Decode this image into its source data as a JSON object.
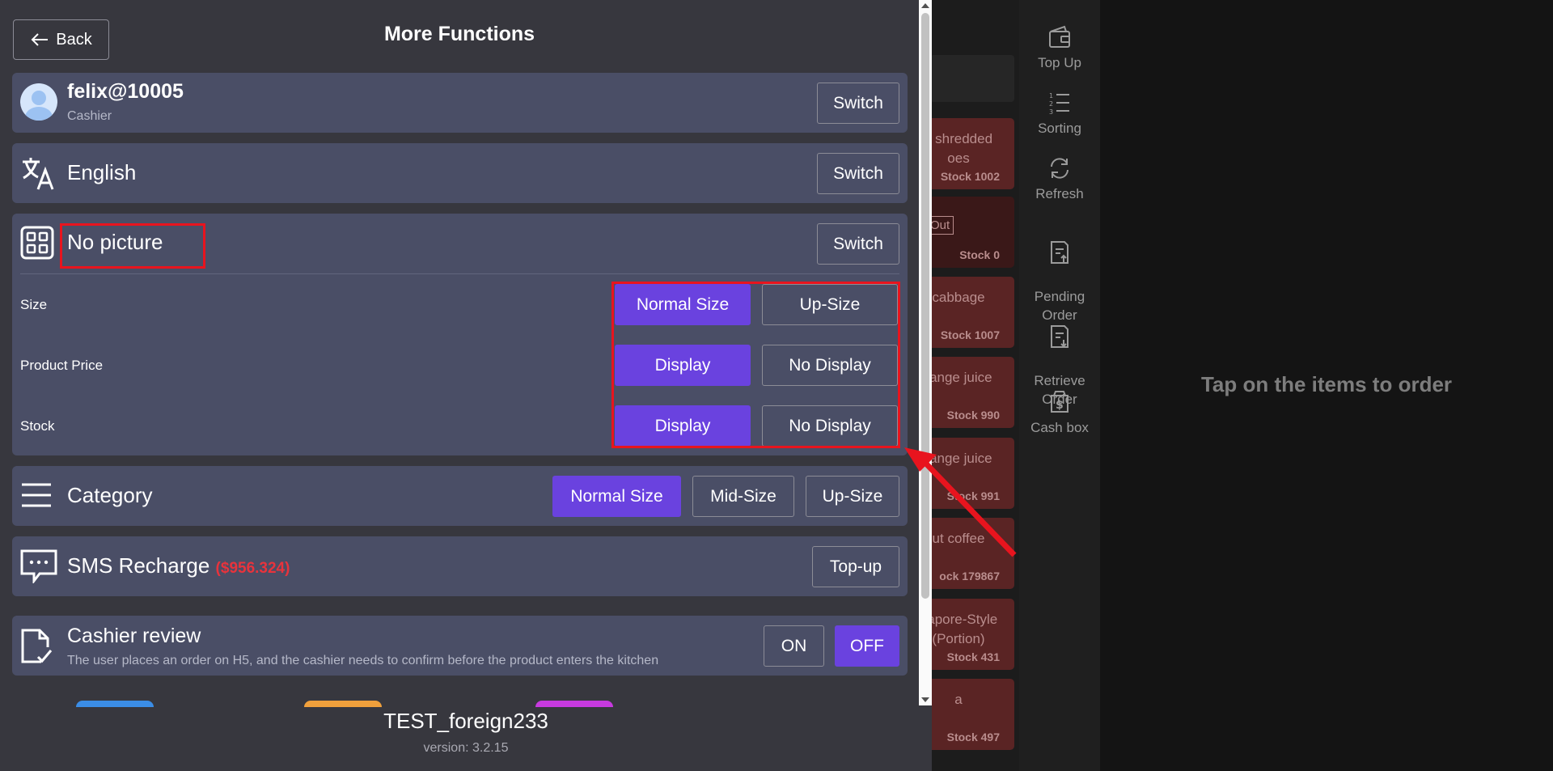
{
  "panel": {
    "back_label": "Back",
    "title": "More Functions"
  },
  "account": {
    "name": "felix@10005",
    "role": "Cashier",
    "switch_label": "Switch"
  },
  "language": {
    "label": "English",
    "switch_label": "Switch"
  },
  "display_mode": {
    "label": "No picture",
    "switch_label": "Switch",
    "rows": [
      {
        "label": "Size",
        "options": [
          "Normal Size",
          "Up-Size"
        ],
        "selected": 0
      },
      {
        "label": "Product Price",
        "options": [
          "Display",
          "No Display"
        ],
        "selected": 0
      },
      {
        "label": "Stock",
        "options": [
          "Display",
          "No Display"
        ],
        "selected": 0
      }
    ]
  },
  "category": {
    "label": "Category",
    "options": [
      "Normal Size",
      "Mid-Size",
      "Up-Size"
    ],
    "selected": 0
  },
  "sms": {
    "label": "SMS Recharge",
    "balance": "($956.324)",
    "topup_label": "Top-up"
  },
  "cashier_review": {
    "label": "Cashier review",
    "description": "The user places an order on H5, and the cashier needs to confirm before the product enters the kitchen",
    "on_label": "ON",
    "off_label": "OFF",
    "selected": "OFF"
  },
  "footer": {
    "store_name": "TEST_foreign233",
    "version": "version: 3.2.15"
  },
  "background": {
    "products": [
      {
        "name": "y shredded\noes",
        "stock": "Stock 1002"
      },
      {
        "name": "",
        "tag": "Out",
        "stock": "Stock 0"
      },
      {
        "name": "cabbage",
        "stock": "Stock 1007"
      },
      {
        "name": "range juice",
        "stock": "Stock 990"
      },
      {
        "name": "range juice",
        "stock": "Stock 991"
      },
      {
        "name": "ut coffee",
        "stock": "ock 179867"
      },
      {
        "name": "gapore-Style\n(Portion)",
        "stock": "Stock 431"
      },
      {
        "name": "a",
        "stock": "Stock 497"
      }
    ],
    "sidebar": [
      {
        "label": "Top Up",
        "icon": "wallet-icon"
      },
      {
        "label": "Sorting",
        "icon": "sort-list-icon"
      },
      {
        "label": "Refresh",
        "icon": "refresh-icon"
      },
      {
        "label": "Pending\nOrder",
        "icon": "pending-order-icon"
      },
      {
        "label": "Retrieve\nOrder",
        "icon": "retrieve-order-icon"
      },
      {
        "label": "Cash box",
        "icon": "cash-box-icon"
      }
    ],
    "order_hint": "Tap on the items to order"
  },
  "colors": {
    "panel_bg": "#37373e",
    "card_bg": "#4a4e66",
    "primary": "#6a42df",
    "balance_red": "#e8333c",
    "annotation_red": "#e8141e",
    "product_bg": "#5a2424"
  }
}
